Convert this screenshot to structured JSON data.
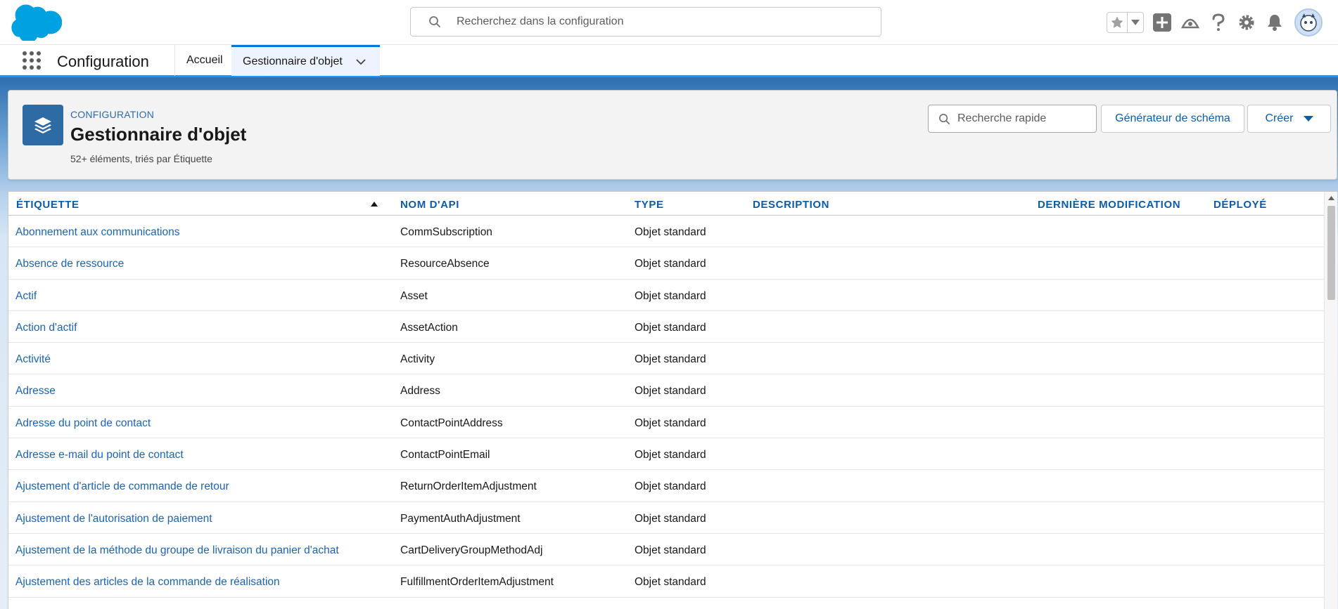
{
  "global_search": {
    "placeholder": "Recherchez dans la configuration"
  },
  "app": {
    "name": "Configuration"
  },
  "nav_tabs": [
    {
      "label": "Accueil"
    },
    {
      "label": "Gestionnaire d'objet"
    }
  ],
  "page_header": {
    "eyebrow": "CONFIGURATION",
    "title": "Gestionnaire d'objet",
    "meta": "52+ éléments, triés par Étiquette",
    "quick_find_placeholder": "Recherche rapide",
    "schema_button": "Générateur de schéma",
    "create_button": "Créer"
  },
  "colors": {
    "brand_blue": "#0176d3",
    "link_blue": "#1b64b3",
    "header_blue": "#0b5cab",
    "object_icon_bg": "#2e6aa3"
  },
  "icons": [
    "salesforce-cloud-logo",
    "search-icon",
    "star-icon",
    "chevron-down-icon",
    "add-icon",
    "trailhead-icon",
    "help-icon",
    "gear-icon",
    "bell-icon",
    "avatar",
    "app-launcher-icon",
    "layers-icon",
    "sort-ascending-icon"
  ],
  "table": {
    "columns": [
      "ÉTIQUETTE",
      "NOM D'API",
      "TYPE",
      "DESCRIPTION",
      "DERNIÈRE MODIFICATION",
      "DÉPLOYÉ"
    ],
    "sorted_by": "ÉTIQUETTE",
    "rows": [
      {
        "label": "Abonnement aux communications",
        "api": "CommSubscription",
        "type": "Objet standard"
      },
      {
        "label": "Absence de ressource",
        "api": "ResourceAbsence",
        "type": "Objet standard"
      },
      {
        "label": "Actif",
        "api": "Asset",
        "type": "Objet standard"
      },
      {
        "label": "Action d'actif",
        "api": "AssetAction",
        "type": "Objet standard"
      },
      {
        "label": "Activité",
        "api": "Activity",
        "type": "Objet standard"
      },
      {
        "label": "Adresse",
        "api": "Address",
        "type": "Objet standard"
      },
      {
        "label": "Adresse du point de contact",
        "api": "ContactPointAddress",
        "type": "Objet standard"
      },
      {
        "label": "Adresse e-mail du point de contact",
        "api": "ContactPointEmail",
        "type": "Objet standard"
      },
      {
        "label": "Ajustement d'article de commande de retour",
        "api": "ReturnOrderItemAdjustment",
        "type": "Objet standard"
      },
      {
        "label": "Ajustement de l'autorisation de paiement",
        "api": "PaymentAuthAdjustment",
        "type": "Objet standard"
      },
      {
        "label": "Ajustement de la méthode du groupe de livraison du panier d'achat",
        "api": "CartDeliveryGroupMethodAdj",
        "type": "Objet standard"
      },
      {
        "label": "Ajustement des articles de la commande de réalisation",
        "api": "FulfillmentOrderItemAdjustment",
        "type": "Objet standard"
      }
    ]
  }
}
